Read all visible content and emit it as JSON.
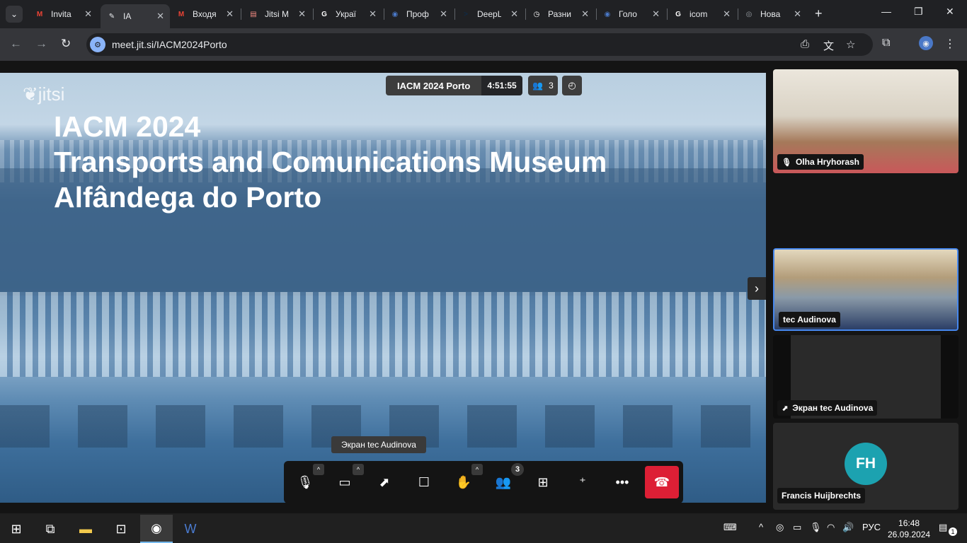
{
  "browser": {
    "tabs": [
      {
        "title": "Invita",
        "favicon": "gmail-icon",
        "color": "#ea4335",
        "glyph": "M"
      },
      {
        "title": "IA",
        "favicon": "jitsi-icon",
        "color": "#e8eaed",
        "glyph": "✎",
        "active": true
      },
      {
        "title": "Входя",
        "favicon": "gmail-icon",
        "color": "#ea4335",
        "glyph": "M"
      },
      {
        "title": "Jitsi M",
        "favicon": "document-icon",
        "color": "#f28b82",
        "glyph": "▤"
      },
      {
        "title": "Украї",
        "favicon": "google-icon",
        "color": "#ffffff",
        "glyph": "G"
      },
      {
        "title": "Проф",
        "favicon": "globe-icon",
        "color": "#4a78c7",
        "glyph": "◉"
      },
      {
        "title": "DeepL",
        "favicon": "deepl-icon",
        "color": "#0f2b46",
        "glyph": ">"
      },
      {
        "title": "Разни",
        "favicon": "clock-icon",
        "color": "#ffffff",
        "glyph": "◷"
      },
      {
        "title": "Голо",
        "favicon": "globe-icon",
        "color": "#4a78c7",
        "glyph": "◉"
      },
      {
        "title": "icom",
        "favicon": "google-icon",
        "color": "#ffffff",
        "glyph": "G"
      },
      {
        "title": "Нова",
        "favicon": "chrome-icon",
        "color": "#9aa0a6",
        "glyph": "◎"
      }
    ],
    "url": "meet.jit.si/IACM2024Porto"
  },
  "meeting": {
    "name": "IACM 2024 Porto",
    "timer": "4:51:55",
    "participant_count": "3",
    "logo_text": "jitsi",
    "screen_share_label": "Экран tec Audinova",
    "participants_badge": "3"
  },
  "slide": {
    "line1": "IACM 2024",
    "line2": "Transports and Comunications Museum",
    "line3": "Alfândega do Porto"
  },
  "filmstrip": {
    "tile1_name": "Olha Hryhorash",
    "tile2_name": "tec Audinova",
    "tile3_name": "Экран tec Audinova",
    "tile4_name": "Francis Huijbrechts",
    "tile4_initials": "FH",
    "tile4_color": "#1ca2b0"
  },
  "taskbar": {
    "lang": "РУС",
    "time": "16:48",
    "date": "26.09.2024",
    "notif_count": "1"
  }
}
